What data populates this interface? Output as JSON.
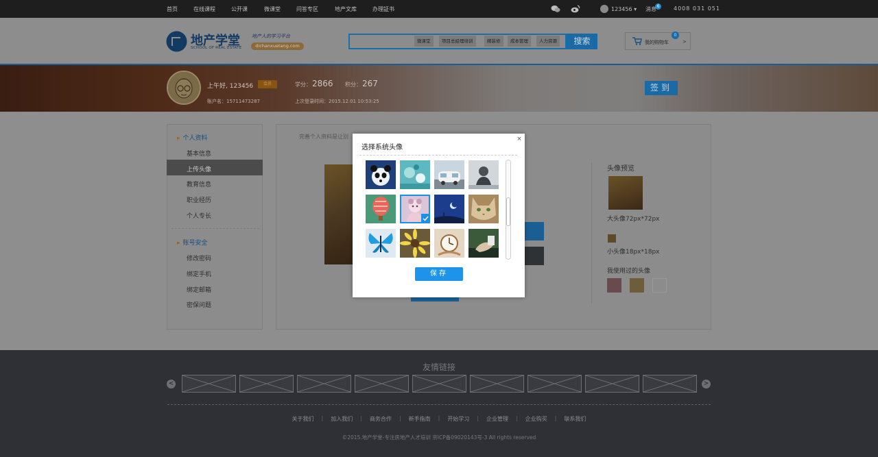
{
  "topnav": {
    "items": [
      "首页",
      "在线课程",
      "公开课",
      "微课堂",
      "问答专区",
      "地产文库",
      "办理証书"
    ],
    "user": "123456 ▾",
    "messages_label": "消息",
    "messages_count": "6",
    "phone": "4008 031 051"
  },
  "header": {
    "logo_cn": "地产学堂",
    "logo_en": "SCHOOL OF REAL ESTATE",
    "slogan": "地产人的学习平台",
    "url": "dichanxuetang.com",
    "search_tags": [
      "微课堂",
      "项目总经理培训",
      "精装修",
      "成本管理",
      "人力资源"
    ],
    "search_button": "搜索",
    "cart_label": "我的购物车",
    "cart_count": "0",
    "cart_arrow": ">"
  },
  "banner": {
    "greeting": "上午好, 123456",
    "vip": "会员",
    "xuefen_label": "学分：",
    "xuefen_value": "2866",
    "jifen_label": "积分：",
    "jifen_value": "267",
    "account": "账户名：15711473287",
    "last_login": "上次登录时间：2015.12.01 10:53:25",
    "checkin": "签到"
  },
  "sidebar": {
    "group1": "个人资料",
    "items1": [
      "基本信息",
      "上传头像",
      "教育信息",
      "职业经历",
      "个人专长"
    ],
    "group2": "账号安全",
    "items2": [
      "修改密码",
      "绑定手机",
      "绑定邮箱",
      "密保问题"
    ]
  },
  "main": {
    "hint": "完善个人资料是让别",
    "preview_title": "头像预览",
    "big_label": "大头像72px*72px",
    "small_label": "小头像18px*18px",
    "used_title": "我使用过的头像"
  },
  "modal": {
    "title": "选择系统头像",
    "close": "×",
    "save": "保存",
    "avatars": [
      "panda-avatar",
      "flowers-avatar",
      "van-avatar",
      "girl-avatar",
      "balloon-avatar",
      "cartoon-girl-avatar",
      "moon-avatar",
      "cat-avatar",
      "butterfly-avatar",
      "sunflower-avatar",
      "clock-avatar",
      "hand-avatar"
    ],
    "selected_index": 5
  },
  "footer": {
    "friend_links_title": "友情链接",
    "prev": "<",
    "next": ">",
    "links": [
      "关于我们",
      "加入我们",
      "商务合作",
      "新手指南",
      "开始学习",
      "企业管理",
      "企业购买",
      "联系我们"
    ],
    "copyright": "©2015.地产学堂-专注房地产人才培训 京ICP备09020143号-3 All rights reserved"
  },
  "colors": {
    "accent": "#1e93ea",
    "topbar": "#1e1e1e",
    "footer": "#2f3035",
    "overlay": "#8e8e8e"
  }
}
